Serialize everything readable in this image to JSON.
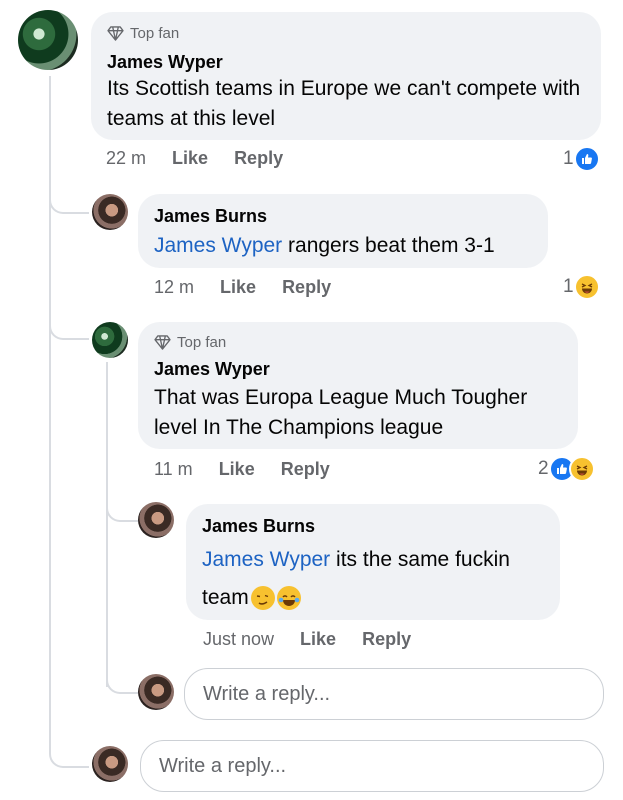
{
  "comments": [
    {
      "badge": "Top fan",
      "author": "James Wyper",
      "text": "Its Scottish teams in Europe we can't compete with teams at this level",
      "time": "22 m",
      "like_label": "Like",
      "reply_label": "Reply",
      "reaction_count": "1",
      "reactions": [
        "like-icon"
      ]
    },
    {
      "author": "James Burns",
      "mention": "James Wyper",
      "text": " rangers beat them 3-1",
      "time": "12 m",
      "like_label": "Like",
      "reply_label": "Reply",
      "reaction_count": "1",
      "reactions": [
        "haha-icon"
      ]
    },
    {
      "badge": "Top fan",
      "author": "James Wyper",
      "text": "That was Europa League Much Tougher level In The Champions league",
      "time": "11 m",
      "like_label": "Like",
      "reply_label": "Reply",
      "reaction_count": "2",
      "reactions": [
        "like-icon",
        "haha-icon"
      ]
    },
    {
      "author": "James Burns",
      "mention": "James Wyper",
      "text": " its the same fuckin",
      "text2": "team",
      "time": "Just now",
      "like_label": "Like",
      "reply_label": "Reply",
      "emojis": [
        "woozy-face-icon",
        "tears-of-joy-icon"
      ]
    }
  ],
  "reply_inputs": [
    {
      "placeholder": "Write a reply..."
    },
    {
      "placeholder": "Write a reply..."
    }
  ],
  "colors": {
    "bubble": "#f0f2f5",
    "mention": "#1d63c3",
    "like_blue": "#1877f2",
    "haha_yellow": "#f7c12f",
    "meta_gray": "#65676b"
  }
}
